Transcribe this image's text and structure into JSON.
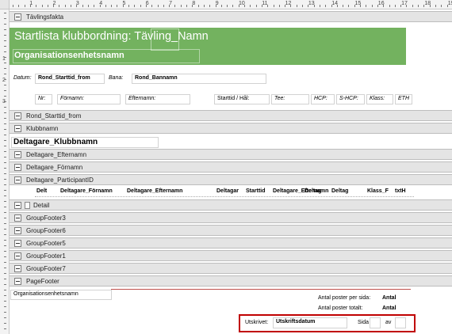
{
  "ruler_top": [
    "1",
    "2",
    "3",
    "4",
    "5",
    "6",
    "7",
    "8",
    "9",
    "10",
    "11",
    "12",
    "13",
    "14",
    "15",
    "16",
    "17",
    "18",
    "19"
  ],
  "ruler_left": [
    "1",
    "2",
    "3"
  ],
  "bands": {
    "tavlingsfakta": "Tävlingsfakta",
    "rond_starttid_from": "Rond_Starttid_from",
    "klubbnamn": "Klubbnamn",
    "deltagare_efternamn": "Deltagare_Efternamn",
    "deltagare_fornamn": "Deltagare_Förnamn",
    "deltagare_participant_id": "Deltagare_ParticipantID",
    "detail": "Detail",
    "group_footer_3": "GroupFooter3",
    "group_footer_6": "GroupFooter6",
    "group_footer_5": "GroupFooter5",
    "group_footer_1": "GroupFooter1",
    "group_footer_7": "GroupFooter7",
    "page_footer": "PageFooter"
  },
  "header": {
    "title": "Startlista klubbordning:  Tävling_Namn",
    "org_name": "Organisationsenhetsnamn",
    "bg_color": "#73b25f"
  },
  "round": {
    "datum_label": "Datum:",
    "datum_value": "Rond_Starttid_from",
    "bana_label": "Bana:",
    "bana_value": "Rond_Bannamn"
  },
  "columns": {
    "nr": "Nr:",
    "fornamn": "Förnamn:",
    "efternamn": "Efternamn:",
    "starttid": "Starttid / Hål:",
    "tee": "Tee:",
    "hcp": "HCP:",
    "s_hcp": "S-HCP:",
    "klass": "Klass:",
    "eth": "ETH"
  },
  "club": {
    "value": "Deltagare_Klubbnamn"
  },
  "participant_row": {
    "c1": "Delt",
    "c2": "Deltagare_Förnamn",
    "c3": "Deltagare_Efternamn",
    "c4": "Deltagar",
    "c5": "Starttid",
    "c6": "Deltagare_Efternamn",
    "c7": "Deltag",
    "c8": "Deltag",
    "c9": "Klass_F",
    "c10": "txtH"
  },
  "footer": {
    "org_name": "Organisationsenhetsnamn",
    "per_page_label": "Antal poster per sida:",
    "per_page_value": "Antal",
    "total_label": "Antal poster totalt:",
    "total_value": "Antal",
    "printed_label": "Utskrivet:",
    "printed_value": "Utskriftsdatum",
    "page_label": "Sida",
    "of_label": "av",
    "highlight_color": "#c00000"
  }
}
